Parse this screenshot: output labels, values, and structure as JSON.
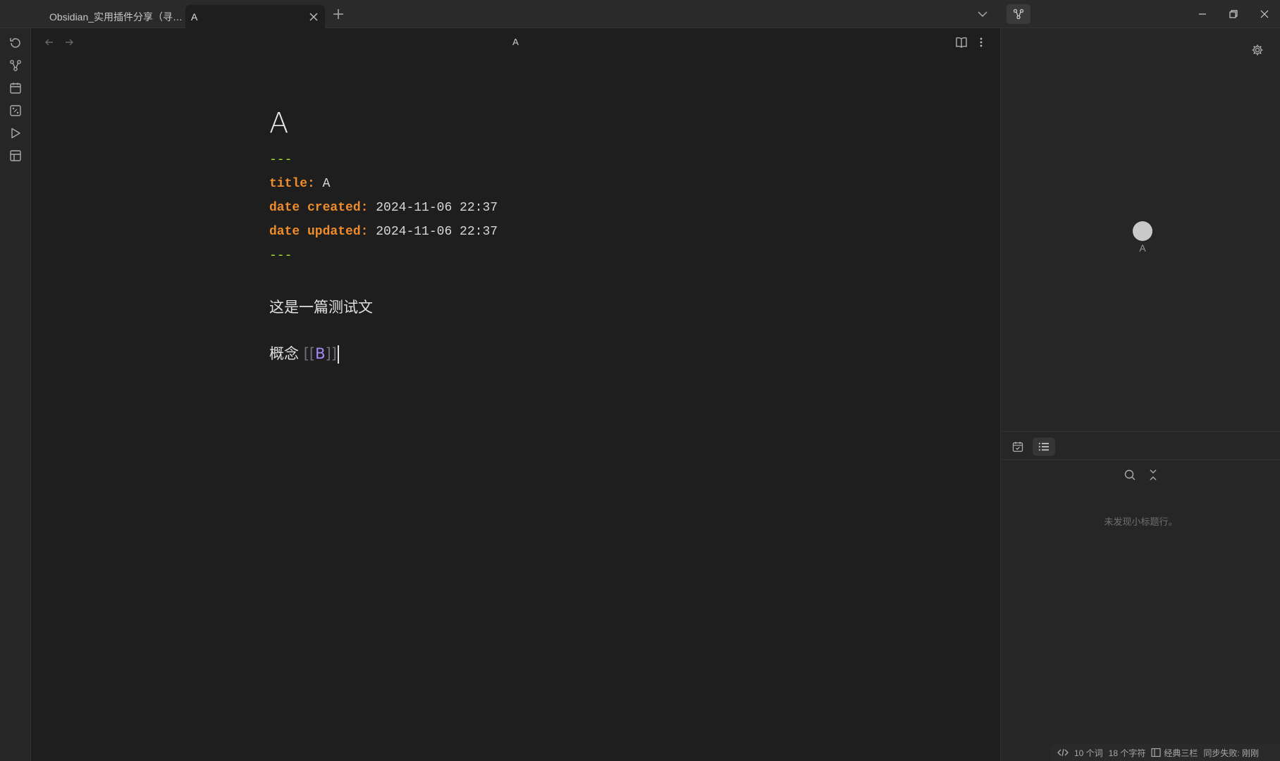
{
  "tabs": [
    {
      "label": "Obsidian_实用插件分享（寻找..."
    },
    {
      "label": "A"
    }
  ],
  "editor": {
    "view_title": "A",
    "heading": "A",
    "frontmatter": {
      "delimiter": "---",
      "lines": [
        {
          "key": "title",
          "value": " A"
        },
        {
          "key": "date created",
          "value": " 2024-11-06 22:37"
        },
        {
          "key": "date updated",
          "value": " 2024-11-06 22:37"
        }
      ]
    },
    "paragraph1": "这是一篇测试文",
    "paragraph2_prefix": "概念 ",
    "link_open": "[[",
    "link_text": "B",
    "link_close": "]]"
  },
  "graph": {
    "node_label": "A"
  },
  "outline": {
    "empty_text": "未发现小标题行。"
  },
  "status": {
    "words": "10 个词",
    "chars": "18 个字符",
    "layout": "经典三栏",
    "sync": "同步失败: 刚刚"
  },
  "colors": {
    "background": "#1e1e1e",
    "frontmatter_key": "#ef8c2b",
    "frontmatter_dash": "#a6e22e",
    "link": "#a68af9"
  },
  "icons": [
    "sync-icon",
    "graph-icon",
    "calendar-icon",
    "random-icon",
    "play-icon",
    "template-icon",
    "chevron-down-icon",
    "book-open-icon",
    "more-vertical-icon",
    "gear-icon",
    "calendar-check-icon",
    "list-icon",
    "search-icon",
    "collapse-icon",
    "code-icon",
    "layout-icon"
  ]
}
